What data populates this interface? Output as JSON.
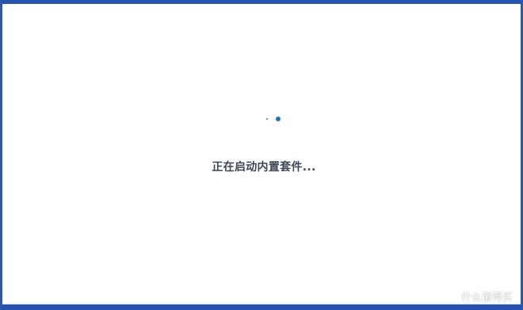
{
  "loading": {
    "message": "正在启动内置套件..."
  },
  "watermark": {
    "text": "什么值得买"
  },
  "colors": {
    "frame_accent": "#2753b0",
    "spinner": "#1f73c4",
    "text": "#3e4654",
    "background": "#ffffff"
  }
}
